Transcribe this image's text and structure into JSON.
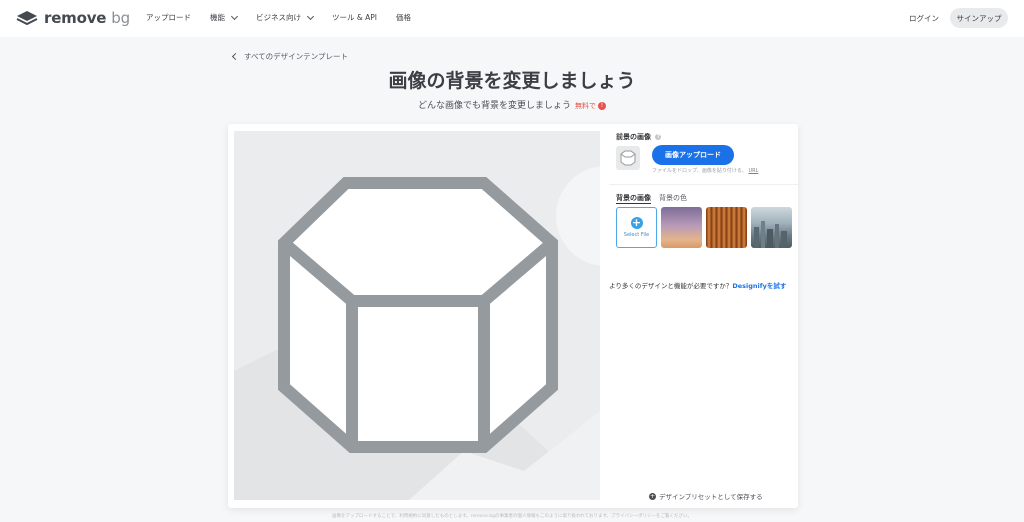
{
  "brand": {
    "name": "remove",
    "suffix": "bg"
  },
  "nav": {
    "items": [
      {
        "label": "アップロード",
        "dropdown": false
      },
      {
        "label": "機能",
        "dropdown": true
      },
      {
        "label": "ビジネス向け",
        "dropdown": true
      },
      {
        "label": "ツール & API",
        "dropdown": false
      },
      {
        "label": "価格",
        "dropdown": false
      }
    ],
    "login": "ログイン",
    "signup": "サインアップ"
  },
  "page": {
    "back_link": "すべてのデザインテンプレート",
    "title": "画像の背景を変更しましょう",
    "subtitle": "どんな画像でも背景を変更しましょう",
    "free_badge": "無料で",
    "info_icon": "!"
  },
  "editor": {
    "foreground_label": "前景の画像",
    "upload_button": "画像アップロード",
    "drop_hint": "ファイルをドロップ、画像を貼り付ける、",
    "drop_hint_url": "URL",
    "tabs": {
      "bg_image": "背景の画像",
      "bg_color": "背景の色"
    },
    "select_file": "Select File",
    "promo_text": "より多くのデザインと機能が必要ですか？",
    "promo_link": "Designifyを試す",
    "save_preset": "デザインプリセットとして保存する"
  },
  "footer": {
    "note": "画像をアップロードすることで、利用規約に同意したものとします。remove.bgの事業者の個人情報もこのように取り扱われております。プライバシーポリシーをご覧ください。"
  },
  "colors": {
    "accent": "#1b72e8",
    "free": "#e5534b",
    "select_border": "#4fa8e8"
  },
  "icons": {
    "logo": "layers-icon",
    "back": "chevron-left-icon",
    "placeholder": "hexagon-box-icon",
    "upload_thumb": "box-icon",
    "add": "plus-circle-icon"
  }
}
